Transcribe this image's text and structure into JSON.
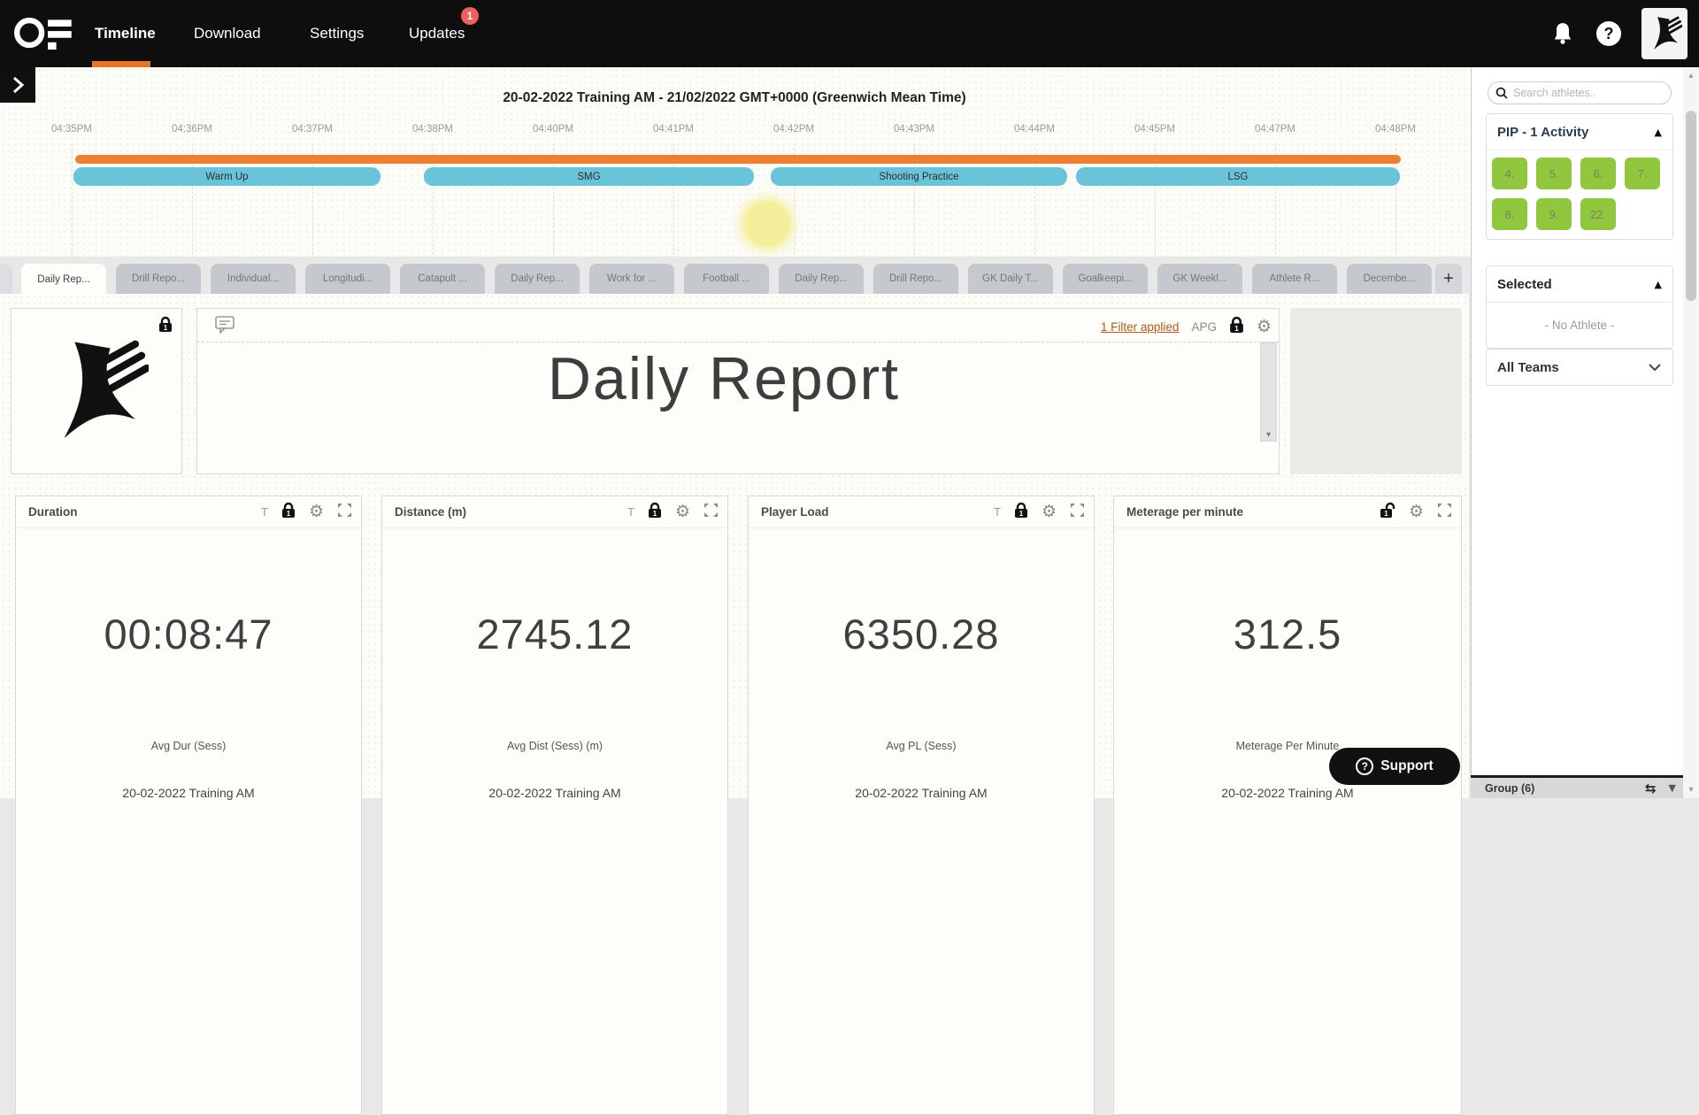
{
  "nav": {
    "brand": "OF",
    "items": [
      {
        "label": "Timeline",
        "active": true
      },
      {
        "label": "Download",
        "active": false
      },
      {
        "label": "Settings",
        "active": false
      },
      {
        "label": "Updates",
        "active": false,
        "badge": "1"
      }
    ],
    "accent_orange": "#e87424"
  },
  "timeline": {
    "title": "20-02-2022 Training AM - 21/02/2022 GMT+0000 (Greenwich Mean Time)",
    "ticks": [
      "04:35PM",
      "04:36PM",
      "04:37PM",
      "04:38PM",
      "04:40PM",
      "04:41PM",
      "04:42PM",
      "04:43PM",
      "04:44PM",
      "04:45PM",
      "04:47PM",
      "04:48PM"
    ],
    "session_color": "#ec8032",
    "period_color": "#69c4da",
    "periods": [
      {
        "label": "Warm Up"
      },
      {
        "label": "SMG"
      },
      {
        "label": "Shooting Practice"
      },
      {
        "label": "LSG"
      }
    ]
  },
  "tabs": {
    "items": [
      {
        "label": "Daily Rep..."
      },
      {
        "label": "Drill Repo..."
      },
      {
        "label": "Individual..."
      },
      {
        "label": "Longitudi..."
      },
      {
        "label": "Catapult ..."
      },
      {
        "label": "Daily Rep..."
      },
      {
        "label": "Work for ..."
      },
      {
        "label": "Football ..."
      },
      {
        "label": "Daily Rep..."
      },
      {
        "label": "Drill Repo..."
      },
      {
        "label": "GK Daily T..."
      },
      {
        "label": "Goalkeepi..."
      },
      {
        "label": "GK Weekl..."
      },
      {
        "label": "Athlete R..."
      },
      {
        "label": "Decembe..."
      }
    ],
    "add_label": "+"
  },
  "report": {
    "title": "Daily Report",
    "filter_link": "1 Filter applied",
    "apg_label": "APG",
    "lock_count": "1",
    "cards": [
      {
        "title": "Duration",
        "value": "00:08:47",
        "metric": "Avg Dur (Sess)",
        "session": "20-02-2022 Training AM",
        "t_label": "T",
        "lock_count": "1"
      },
      {
        "title": "Distance (m)",
        "value": "2745.12",
        "metric": "Avg Dist (Sess) (m)",
        "session": "20-02-2022 Training AM",
        "t_label": "T",
        "lock_count": "1"
      },
      {
        "title": "Player Load",
        "value": "6350.28",
        "metric": "Avg PL (Sess)",
        "session": "20-02-2022 Training AM",
        "t_label": "T",
        "lock_count": "1"
      },
      {
        "title": "Meterage per minute",
        "value": "312.5",
        "metric": "Meterage Per Minute",
        "session": "20-02-2022 Training AM",
        "lock_count": "1"
      }
    ]
  },
  "sidebar": {
    "search_placeholder": "Search athletes..",
    "activity_group_title": "PIP - 1 Activity",
    "athletes": [
      "4.",
      "5.",
      "6.",
      "7.",
      "8.",
      "9.",
      "22."
    ],
    "athlete_green": "#90c73e",
    "selected_title": "Selected",
    "selected_empty": "- No Athlete -",
    "teams_label": "All Teams",
    "group_footer": "Group (6)",
    "support_label": "Support"
  }
}
